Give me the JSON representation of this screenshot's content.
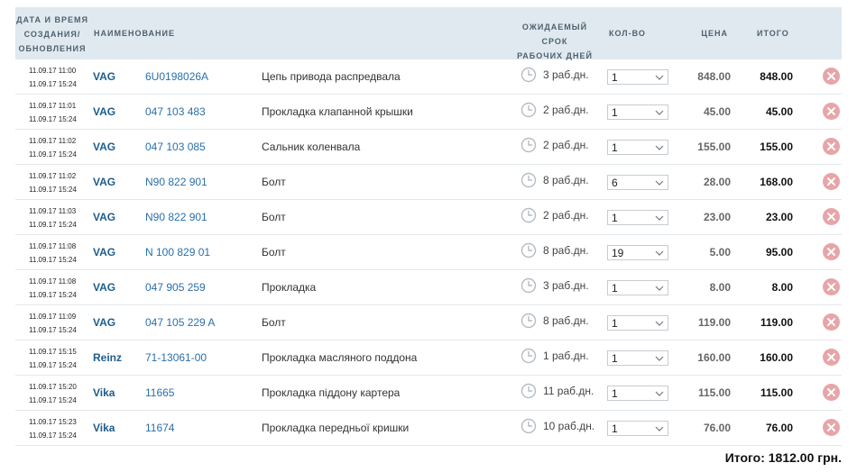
{
  "header": {
    "date_line1": "ДАТА И ВРЕМЯ",
    "date_line2": "СОЗДАНИЯ/",
    "date_line3": "ОБНОВЛЕНИЯ",
    "name": "НАИМЕНОВАНИЕ",
    "term_line1": "ОЖИДАЕМЫЙ СРОК",
    "term_line2": "РАБОЧИХ ДНЕЙ",
    "qty": "КОЛ-ВО",
    "price": "ЦЕНА",
    "total": "ИТОГО"
  },
  "icons": {
    "clock": "clock-icon",
    "delete": "delete-icon",
    "dropdown": "chevron-down-icon"
  },
  "colors": {
    "header_bg": "#dfe9ef",
    "link": "#2a6faa",
    "brand": "#1e5d8c",
    "delete": "#e8a5a8"
  },
  "rows": [
    {
      "created": "11.09.17 11:00",
      "updated": "11.09.17 15:24",
      "brand": "VAG",
      "code": "6U0198026A",
      "name": "Цепь привода распредвала",
      "term": "3 раб.дн.",
      "qty": "1",
      "price": "848.00",
      "total": "848.00"
    },
    {
      "created": "11.09.17 11:01",
      "updated": "11.09.17 15:24",
      "brand": "VAG",
      "code": "047 103 483",
      "name": "Прокладка клапанной крышки",
      "term": "2 раб.дн.",
      "qty": "1",
      "price": "45.00",
      "total": "45.00"
    },
    {
      "created": "11.09.17 11:02",
      "updated": "11.09.17 15:24",
      "brand": "VAG",
      "code": "047 103 085",
      "name": "Сальник коленвала",
      "term": "2 раб.дн.",
      "qty": "1",
      "price": "155.00",
      "total": "155.00"
    },
    {
      "created": "11.09.17 11:02",
      "updated": "11.09.17 15:24",
      "brand": "VAG",
      "code": "N90 822 901",
      "name": "Болт",
      "term": "8 раб.дн.",
      "qty": "6",
      "price": "28.00",
      "total": "168.00"
    },
    {
      "created": "11.09.17 11:03",
      "updated": "11.09.17 15:24",
      "brand": "VAG",
      "code": "N90 822 901",
      "name": "Болт",
      "term": "2 раб.дн.",
      "qty": "1",
      "price": "23.00",
      "total": "23.00"
    },
    {
      "created": "11.09.17 11:08",
      "updated": "11.09.17 15:24",
      "brand": "VAG",
      "code": "N 100 829 01",
      "name": "Болт",
      "term": "8 раб.дн.",
      "qty": "19",
      "price": "5.00",
      "total": "95.00"
    },
    {
      "created": "11.09.17 11:08",
      "updated": "11.09.17 15:24",
      "brand": "VAG",
      "code": "047 905 259",
      "name": "Прокладка",
      "term": "3 раб.дн.",
      "qty": "1",
      "price": "8.00",
      "total": "8.00"
    },
    {
      "created": "11.09.17 11:09",
      "updated": "11.09.17 15:24",
      "brand": "VAG",
      "code": "047 105 229 A",
      "name": "Болт",
      "term": "8 раб.дн.",
      "qty": "1",
      "price": "119.00",
      "total": "119.00"
    },
    {
      "created": "11.09.17 15:15",
      "updated": "11.09.17 15:24",
      "brand": "Reinz",
      "code": "71-13061-00",
      "name": "Прокладка масляного поддона",
      "term": "1 раб.дн.",
      "qty": "1",
      "price": "160.00",
      "total": "160.00"
    },
    {
      "created": "11.09.17 15:20",
      "updated": "11.09.17 15:24",
      "brand": "Vika",
      "code": "11665",
      "name": "Прокладка піддону картера",
      "term": "11 раб.дн.",
      "qty": "1",
      "price": "115.00",
      "total": "115.00"
    },
    {
      "created": "11.09.17 15:23",
      "updated": "11.09.17 15:24",
      "brand": "Vika",
      "code": "11674",
      "name": "Прокладка передньої кришки",
      "term": "10 раб.дн.",
      "qty": "1",
      "price": "76.00",
      "total": "76.00"
    }
  ],
  "grand_total": "Итого: 1812.00 грн."
}
